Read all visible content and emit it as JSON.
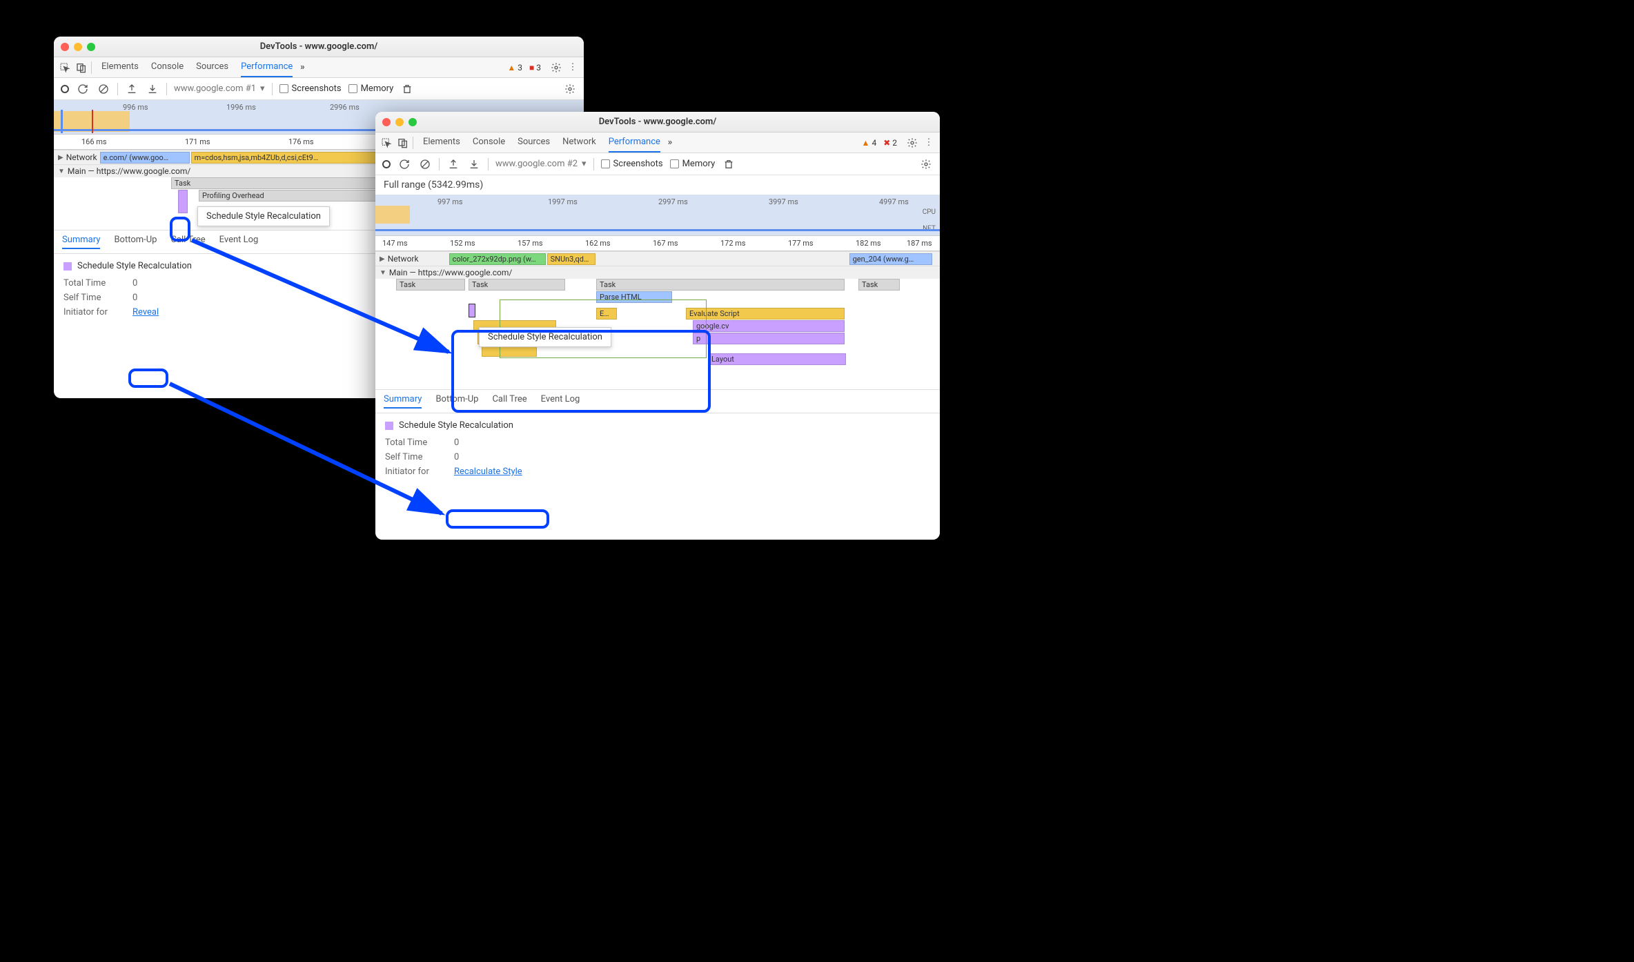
{
  "window1": {
    "title": "DevTools - www.google.com/",
    "tabs": [
      "Elements",
      "Console",
      "Sources",
      "Performance"
    ],
    "active_tab": "Performance",
    "warnings": "3",
    "errors": "3",
    "recording_label": "www.google.com #1",
    "screenshots_label": "Screenshots",
    "memory_label": "Memory",
    "overview_times": [
      "996 ms",
      "1996 ms",
      "2996 ms"
    ],
    "ruler_times": [
      "166 ms",
      "171 ms",
      "176 ms"
    ],
    "network_track": "Network",
    "network_bar1": "e.com/ (www.goo…",
    "network_bar2": "m=cdos,hsm,jsa,mb4ZUb,d,csi,cEt9…",
    "main_track": "Main — https://www.google.com/",
    "task_label": "Task",
    "overhead_label": "Profiling Overhead",
    "tooltip": "Schedule Style Recalculation",
    "bottom_tabs": [
      "Summary",
      "Bottom-Up",
      "Call Tree",
      "Event Log"
    ],
    "active_btab": "Summary",
    "summary_title": "Schedule Style Recalculation",
    "total_time_label": "Total Time",
    "total_time_value": "0",
    "self_time_label": "Self Time",
    "self_time_value": "0",
    "initiator_label": "Initiator for",
    "reveal_link": "Reveal"
  },
  "window2": {
    "title": "DevTools - www.google.com/",
    "tabs": [
      "Elements",
      "Console",
      "Sources",
      "Network",
      "Performance"
    ],
    "active_tab": "Performance",
    "warnings": "4",
    "errors": "2",
    "recording_label": "www.google.com #2",
    "screenshots_label": "Screenshots",
    "memory_label": "Memory",
    "range_text": "Full range (5342.99ms)",
    "overview_times": [
      "997 ms",
      "1997 ms",
      "2997 ms",
      "3997 ms",
      "4997 ms"
    ],
    "overview_right": [
      "CPU",
      "NET"
    ],
    "ruler_times": [
      "147 ms",
      "152 ms",
      "157 ms",
      "162 ms",
      "167 ms",
      "172 ms",
      "177 ms",
      "182 ms",
      "187 ms"
    ],
    "network_track": "Network",
    "net_bar1": "color_272x92dp.png (w…",
    "net_bar2": "SNUn3,qd…",
    "net_bar3": "gen_204 (www.g…",
    "main_track": "Main — https://www.google.com/",
    "task_label": "Task",
    "parse_label": "Parse HTML",
    "e_label": "E…",
    "eval_label": "Evaluate Script",
    "gcv_label": "google.cv",
    "p_label": "p",
    "layout_label": "Layout",
    "tooltip": "Schedule Style Recalculation",
    "bottom_tabs": [
      "Summary",
      "Bottom-Up",
      "Call Tree",
      "Event Log"
    ],
    "active_btab": "Summary",
    "summary_title": "Schedule Style Recalculation",
    "total_time_label": "Total Time",
    "total_time_value": "0",
    "self_time_label": "Self Time",
    "self_time_value": "0",
    "initiator_label": "Initiator for",
    "reveal_link": "Recalculate Style"
  }
}
